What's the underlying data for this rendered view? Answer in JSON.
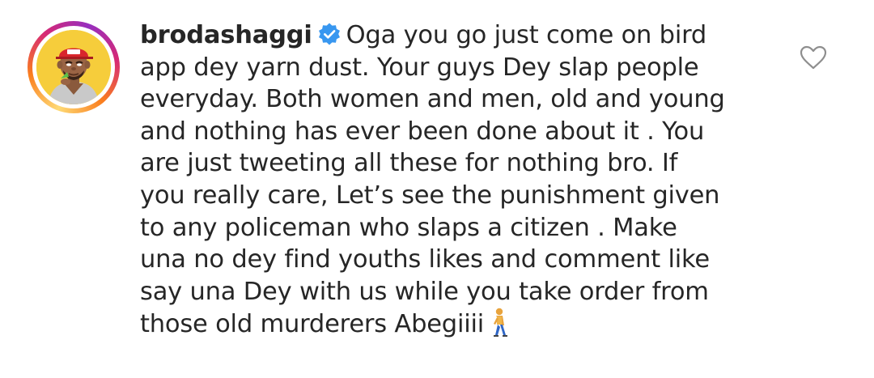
{
  "comment": {
    "avatar_icon": "cartoon-avatar",
    "username": "brodashaggi",
    "verified_icon": "verified-badge-icon",
    "text_lines": [
      "Oga you go just come on bird",
      "app dey yarn dust. Your guys Dey slap people",
      "everyday. Both women and men, old and young",
      "and nothing has ever been done about it . You",
      "are just tweeting all these for nothing bro. If",
      "you really care, Let’s see the punishment given",
      "to any policeman who slaps a citizen . Make",
      "una no dey find youths likes and comment like",
      "say una Dey with us while you take order from",
      "those old murderers  Abegiiii"
    ],
    "trailing_emoji": "person-walking-emoji",
    "like_icon": "heart-outline-icon"
  },
  "colors": {
    "text": "#262626",
    "verified": "#3897f0",
    "icon_gray": "#8e8e8e"
  }
}
